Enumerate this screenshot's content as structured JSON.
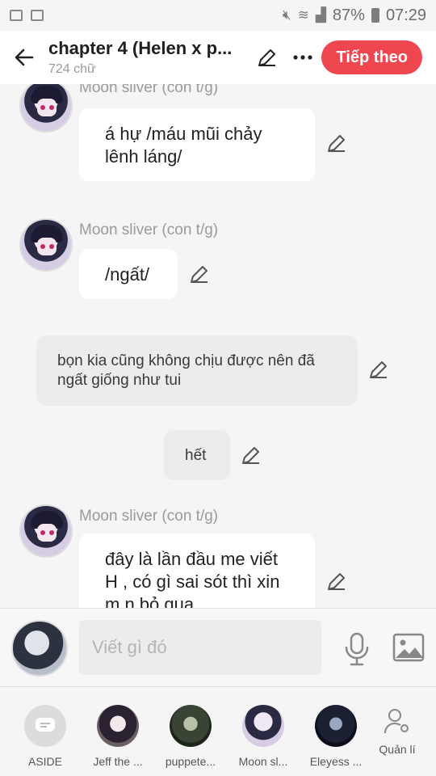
{
  "status_bar": {
    "battery": "87%",
    "time": "07:29"
  },
  "header": {
    "title": "chapter 4 (Helen x p...",
    "subtitle": "724 chữ",
    "next_button": "Tiếp theo"
  },
  "messages": [
    {
      "author": "Moon sliver (con t/g)",
      "text": "á hự /máu mũi chảy lênh láng/"
    },
    {
      "author": "Moon sliver (con t/g)",
      "text": "/ngất/"
    },
    {
      "narration": "bọn kia cũng không chịu được nên đã ngất giống như tui"
    },
    {
      "narration": "hết"
    },
    {
      "author": "Moon sliver (con t/g)",
      "text": "đây là lần đầu me viết H , có gì sai sót thì xin m.n bỏ qua"
    }
  ],
  "input": {
    "placeholder": "Viết gì đó"
  },
  "characters": [
    {
      "label": "ASIDE"
    },
    {
      "label": "Jeff the ..."
    },
    {
      "label": "puppete..."
    },
    {
      "label": "Moon sl..."
    },
    {
      "label": "Eleyess ..."
    },
    {
      "label": "Quản lí"
    }
  ],
  "colors": {
    "accent": "#f0464f",
    "bubble": "#ffffff",
    "narration": "#ececec"
  }
}
